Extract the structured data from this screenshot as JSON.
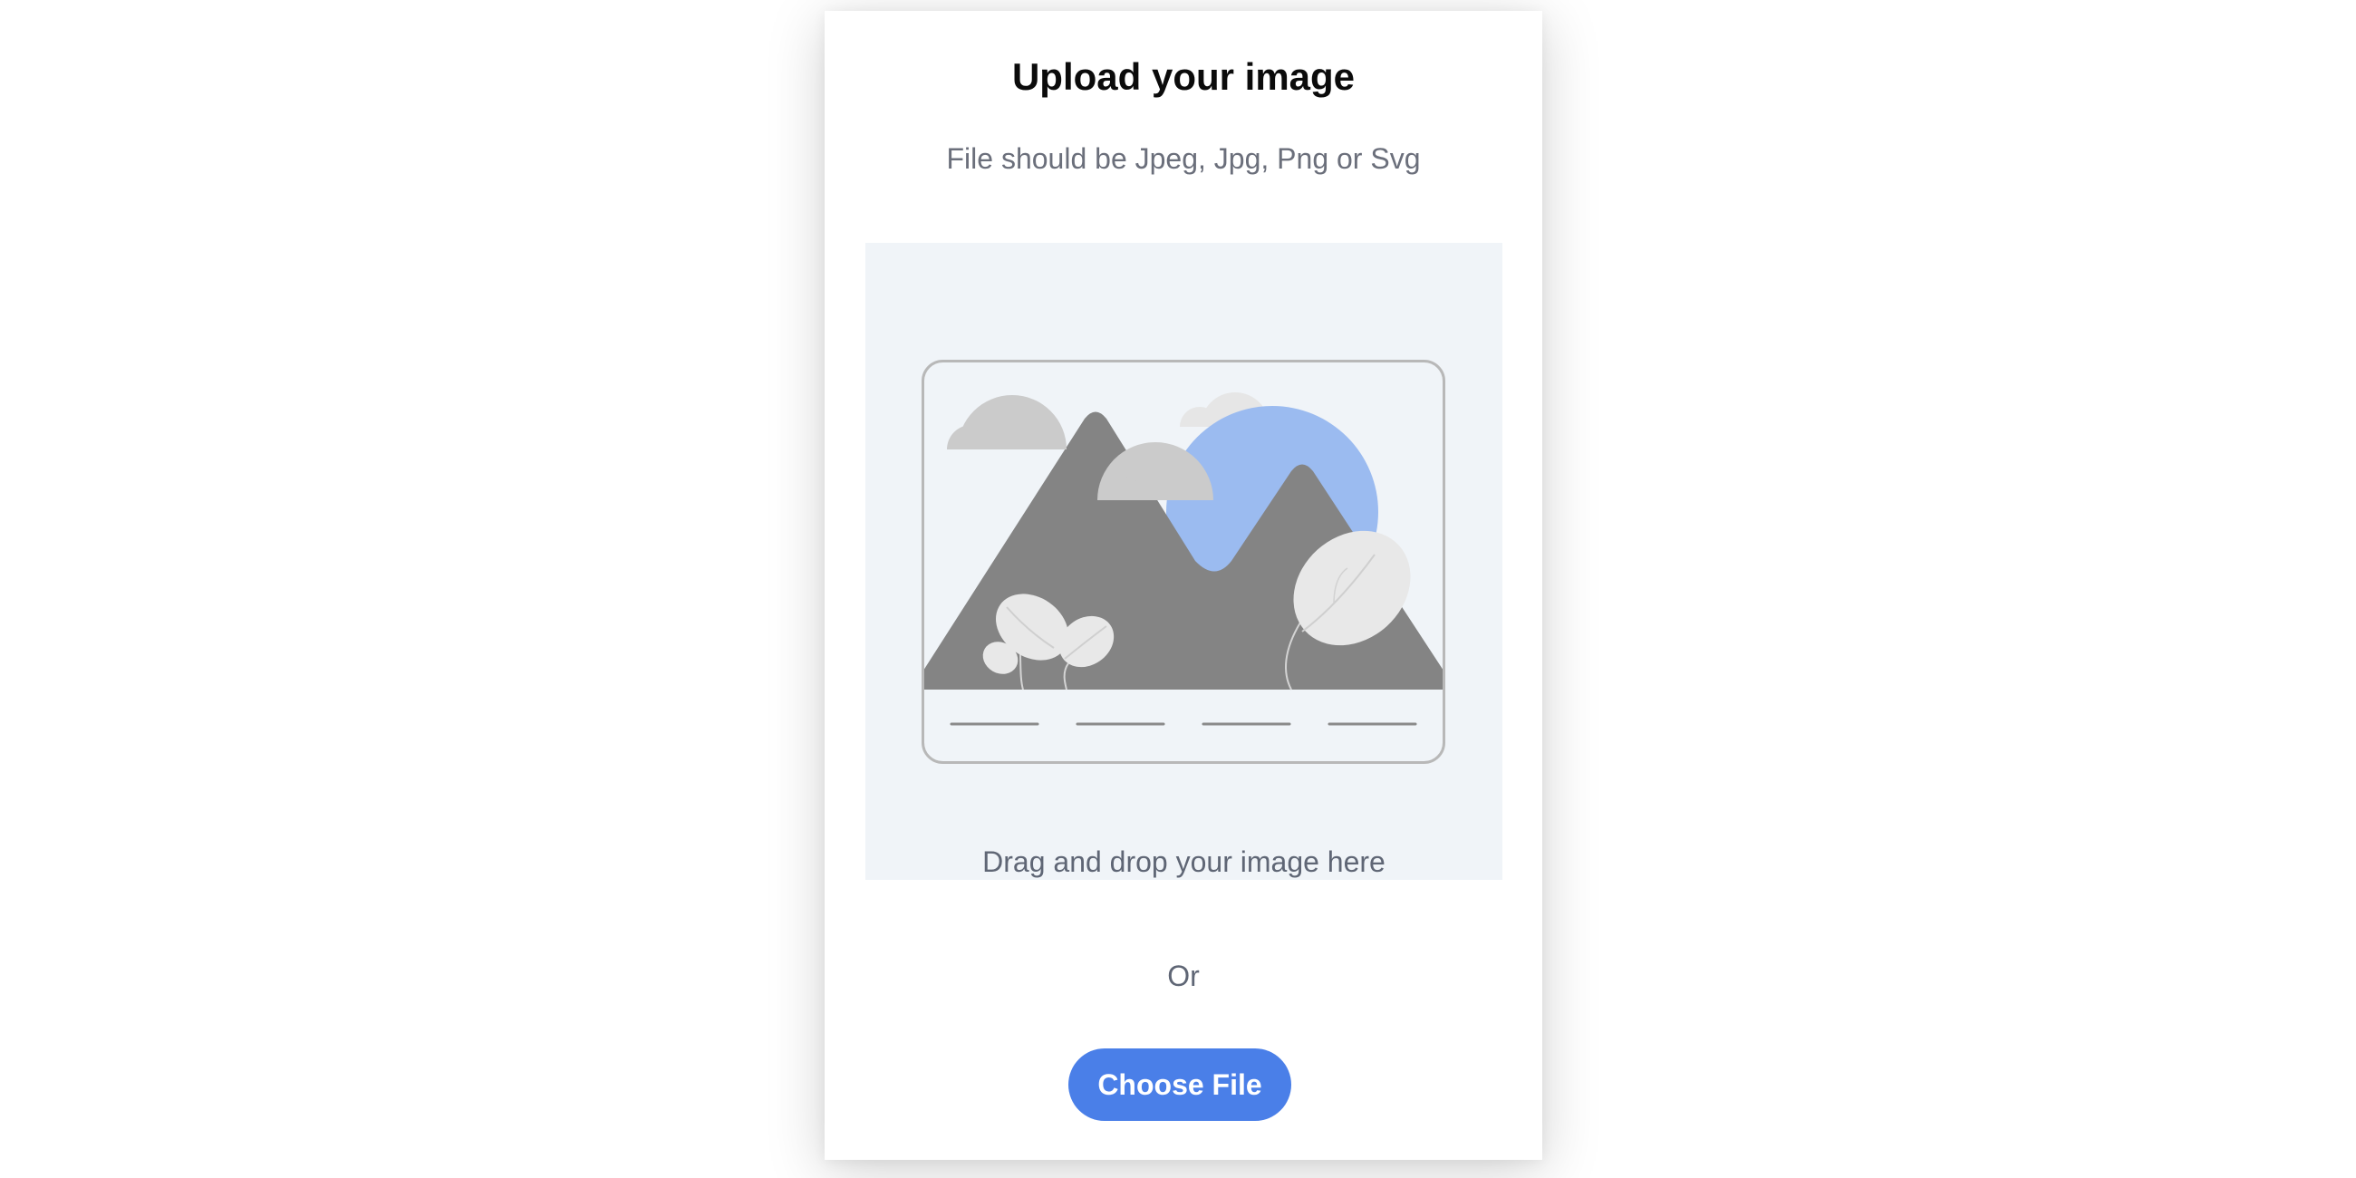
{
  "upload": {
    "title": "Upload your image",
    "subtitle": "File should be Jpeg, Jpg, Png or Svg",
    "dropzone_text": "Drag and drop your image here",
    "or_text": "Or",
    "button_label": "Choose File"
  },
  "colors": {
    "accent": "#4a7fe8",
    "dropzone_bg": "#f0f4f8",
    "sun": "#9bbbf0",
    "mountain": "#848484",
    "cloud": "#cbcbcb"
  },
  "icons": {
    "illustration": "image-placeholder-icon"
  }
}
